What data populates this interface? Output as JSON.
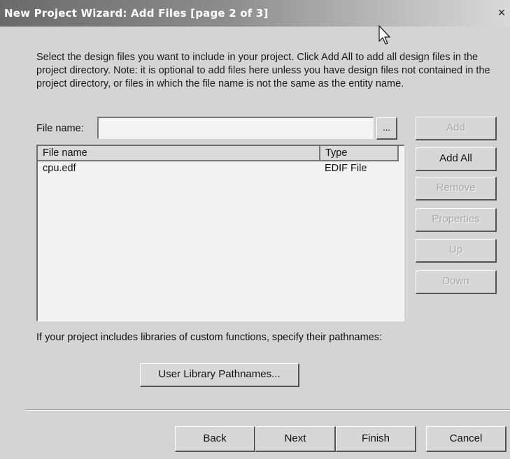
{
  "window": {
    "title": "New Project Wizard: Add Files [page 2 of 3]",
    "close_glyph": "×"
  },
  "intro_text": "Select the design files you want to include in your project. Click Add All to add all design files in the project directory. Note: it is optional to add files here unless you have design files not contained in the project directory, or files in which the file name is not the same as the entity name.",
  "file_name_field": {
    "label": "File name:",
    "value": "",
    "browse_label": "..."
  },
  "side_buttons": {
    "add": "Add",
    "add_all": "Add All",
    "remove": "Remove",
    "properties": "Properties",
    "up": "Up",
    "down": "Down"
  },
  "file_list": {
    "columns": [
      "File name",
      "Type"
    ],
    "rows": [
      {
        "name": "cpu.edf",
        "type": "EDIF File"
      }
    ]
  },
  "library_text": "If your project includes libraries of custom functions, specify their pathnames:",
  "library_button": "User Library Pathnames...",
  "footer_buttons": {
    "back": "Back",
    "next": "Next",
    "finish": "Finish",
    "cancel": "Cancel"
  },
  "icons": {
    "close": "close-icon",
    "cursor": "mouse-cursor-icon"
  }
}
